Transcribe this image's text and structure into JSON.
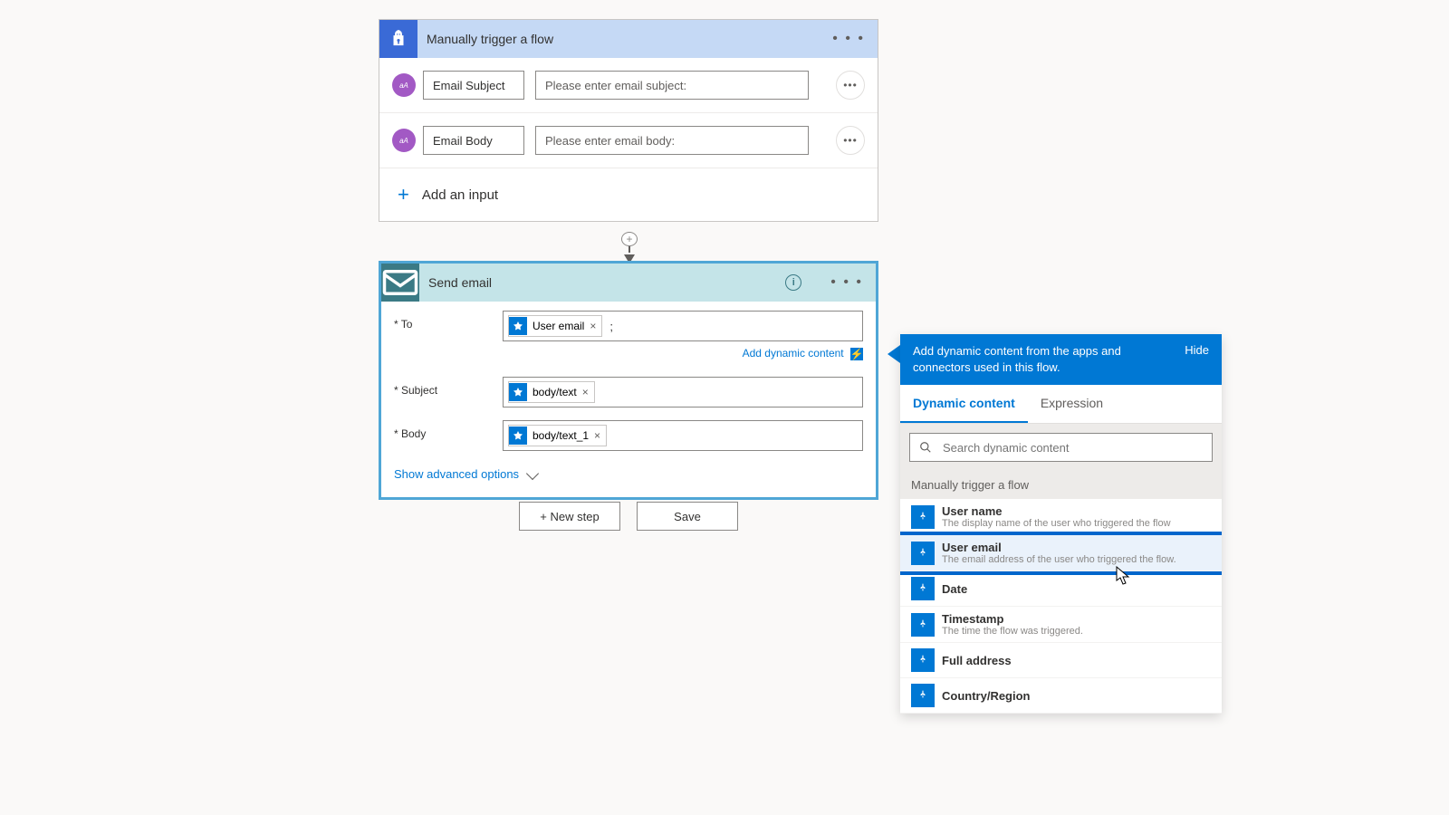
{
  "trigger": {
    "title": "Manually trigger a flow",
    "inputs": [
      {
        "name": "Email Subject",
        "placeholder": "Please enter email subject:"
      },
      {
        "name": "Email Body",
        "placeholder": "Please enter email body:"
      }
    ],
    "add_input_label": "Add an input",
    "aa_label": "aA"
  },
  "action": {
    "title": "Send email",
    "fields": {
      "to": {
        "label": "* To",
        "tokens": [
          "User email"
        ],
        "trailing": ";"
      },
      "subject": {
        "label": "* Subject",
        "tokens": [
          "body/text"
        ]
      },
      "body": {
        "label": "* Body",
        "tokens": [
          "body/text_1"
        ]
      }
    },
    "add_dynamic_label": "Add dynamic content",
    "advanced_label": "Show advanced options"
  },
  "buttons": {
    "new_step": "+ New step",
    "save": "Save"
  },
  "dc_panel": {
    "header_desc": "Add dynamic content from the apps and connectors used in this flow.",
    "hide_label": "Hide",
    "tabs": {
      "dynamic": "Dynamic content",
      "expression": "Expression"
    },
    "search_placeholder": "Search dynamic content",
    "group_title": "Manually trigger a flow",
    "items": [
      {
        "title": "User name",
        "desc": "The display name of the user who triggered the flow"
      },
      {
        "title": "User email",
        "desc": "The email address of the user who triggered the flow.",
        "highlighted": true
      },
      {
        "title": "Date",
        "desc": ""
      },
      {
        "title": "Timestamp",
        "desc": "The time the flow was triggered."
      },
      {
        "title": "Full address",
        "desc": ""
      },
      {
        "title": "Country/Region",
        "desc": ""
      }
    ]
  }
}
